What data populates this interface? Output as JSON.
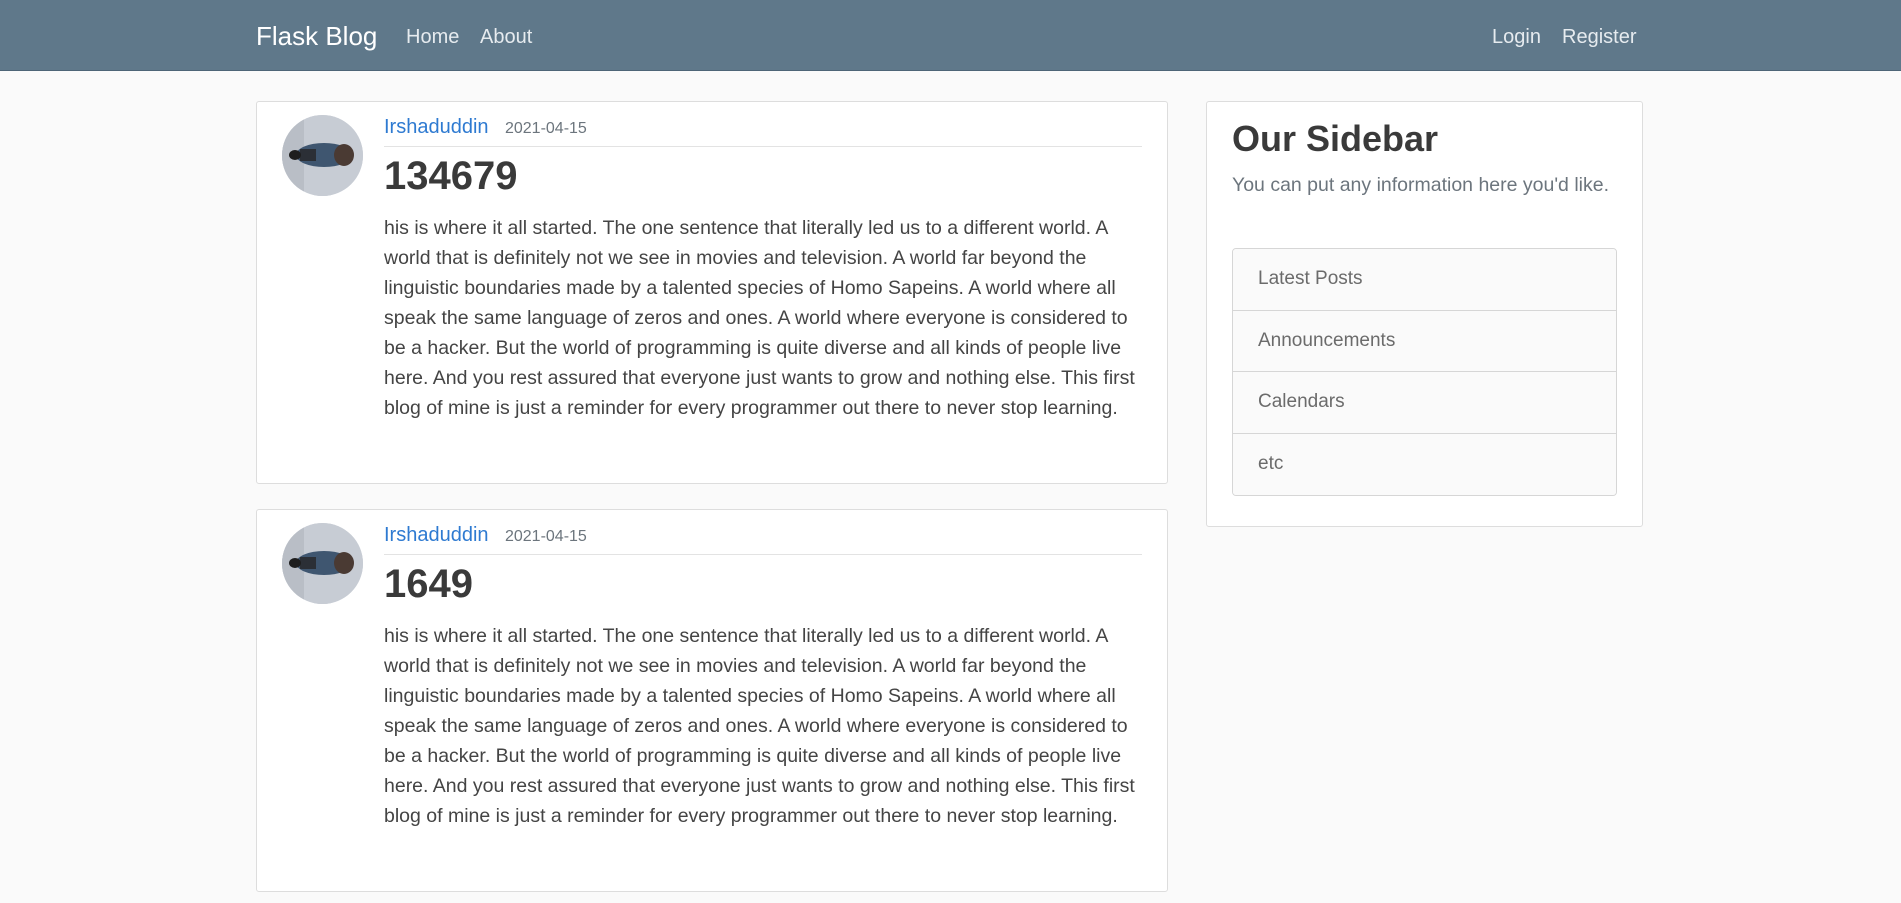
{
  "nav": {
    "brand": "Flask Blog",
    "home": "Home",
    "about": "About",
    "login": "Login",
    "register": "Register"
  },
  "posts": [
    {
      "author": "Irshaduddin",
      "date": "2021-04-15",
      "title": "134679",
      "content": "his is where it all started. The one sentence that literally led us to a different world. A world that is definitely not we see in movies and television. A world far beyond the linguistic boundaries made by a talented species of Homo Sapeins. A world where all speak the same language of zeros and ones. A world where everyone is considered to be a hacker. But the world of programming is quite diverse and all kinds of people live here. And you rest assured that everyone just wants to grow and nothing else. This first blog of mine is just a reminder for every programmer out there to never stop learning."
    },
    {
      "author": "Irshaduddin",
      "date": "2021-04-15",
      "title": "1649",
      "content": "his is where it all started. The one sentence that literally led us to a different world. A world that is definitely not we see in movies and television. A world far beyond the linguistic boundaries made by a talented species of Homo Sapeins. A world where all speak the same language of zeros and ones. A world where everyone is considered to be a hacker. But the world of programming is quite diverse and all kinds of people live here. And you rest assured that everyone just wants to grow and nothing else. This first blog of mine is just a reminder for every programmer out there to never stop learning."
    }
  ],
  "sidebar": {
    "title": "Our Sidebar",
    "description": "You can put any information here you'd like.",
    "items": [
      {
        "label": "Latest Posts"
      },
      {
        "label": "Announcements"
      },
      {
        "label": "Calendars"
      },
      {
        "label": "etc"
      }
    ]
  },
  "colors": {
    "navbar": "#5f788a",
    "link": "#2e7ad1",
    "background": "#fafafa"
  }
}
